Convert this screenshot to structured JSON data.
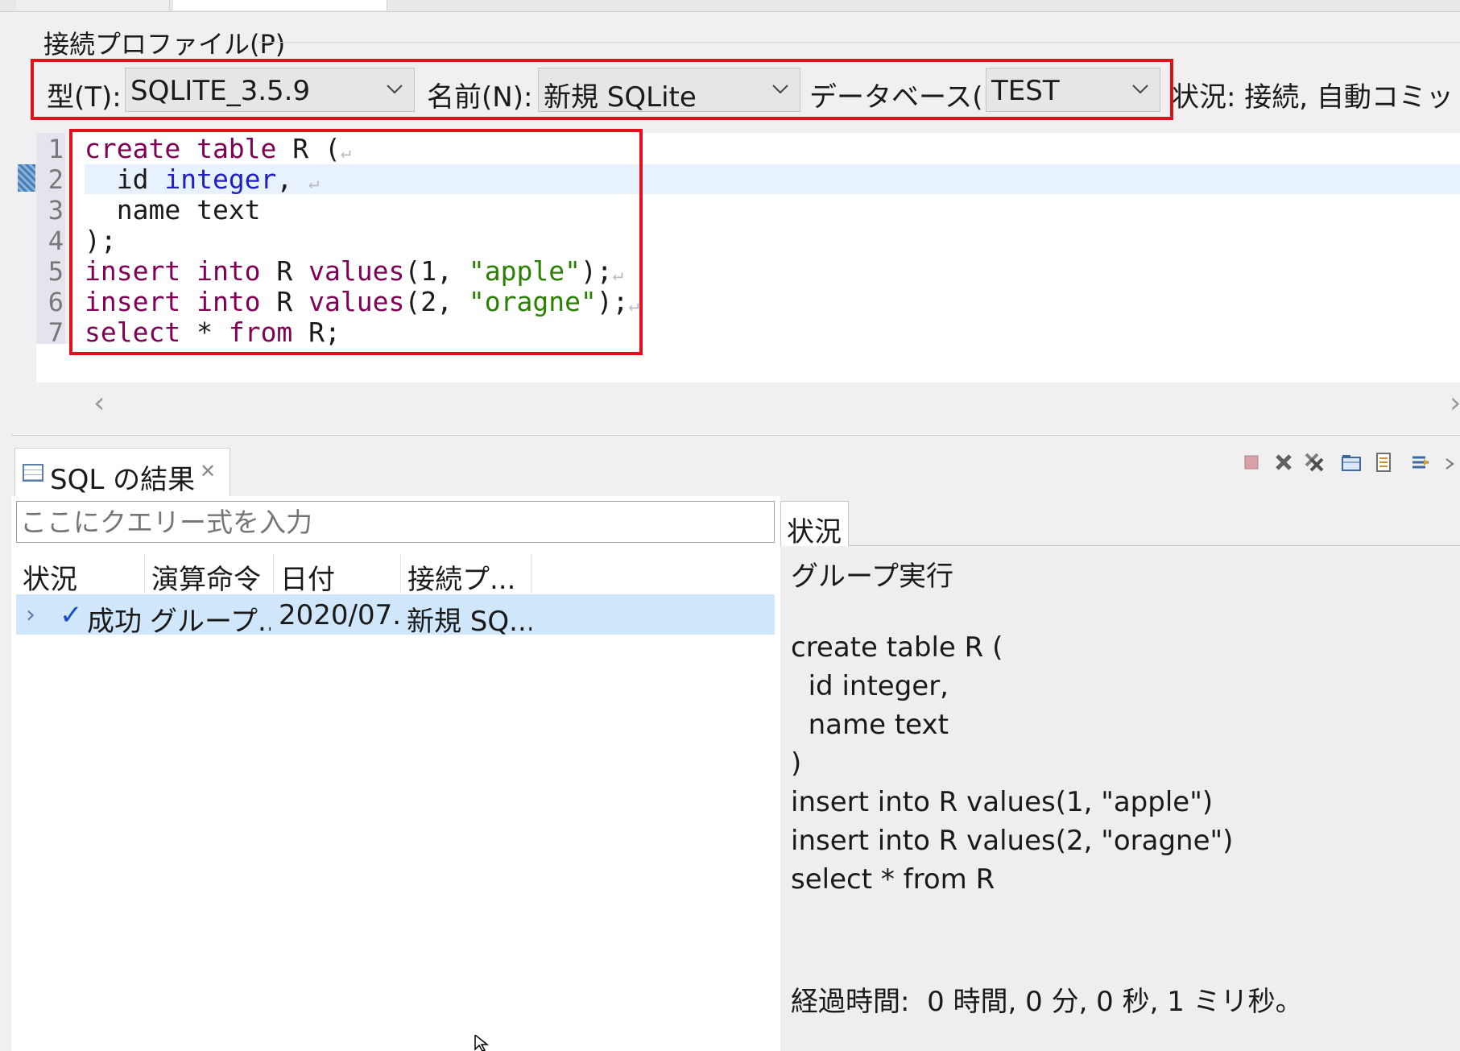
{
  "profile": {
    "title": "接続プロファイル(P)",
    "type_label": "型(T):",
    "type_value": "SQLITE_3.5.9",
    "name_label": "名前(N):",
    "name_value": "新規 SQLite",
    "database_label": "データベース(B):",
    "database_value": "TEST",
    "status_text": "状況: 接続, 自動コミット"
  },
  "editor": {
    "line_numbers": [
      "1",
      "2",
      "3",
      "4",
      "5",
      "6",
      "7"
    ],
    "lines": [
      [
        {
          "t": "create table",
          "c": "kw"
        },
        {
          "t": " R (",
          "c": ""
        }
      ],
      [
        {
          "t": "  id ",
          "c": ""
        },
        {
          "t": "integer",
          "c": "ty"
        },
        {
          "t": ", ",
          "c": ""
        }
      ],
      [
        {
          "t": "  name text",
          "c": ""
        }
      ],
      [
        {
          "t": ");",
          "c": ""
        }
      ],
      [
        {
          "t": "insert into",
          "c": "kw"
        },
        {
          "t": " R ",
          "c": ""
        },
        {
          "t": "values",
          "c": "kw"
        },
        {
          "t": "(1, ",
          "c": ""
        },
        {
          "t": "\"apple\"",
          "c": "st"
        },
        {
          "t": ");",
          "c": ""
        }
      ],
      [
        {
          "t": "insert into",
          "c": "kw"
        },
        {
          "t": " R ",
          "c": ""
        },
        {
          "t": "values",
          "c": "kw"
        },
        {
          "t": "(2, ",
          "c": ""
        },
        {
          "t": "\"oragne\"",
          "c": "st"
        },
        {
          "t": ");",
          "c": ""
        }
      ],
      [
        {
          "t": "select",
          "c": "kw"
        },
        {
          "t": " * ",
          "c": ""
        },
        {
          "t": "from",
          "c": "kw"
        },
        {
          "t": " R;",
          "c": ""
        }
      ]
    ],
    "newline_marker": "↵"
  },
  "results": {
    "tab_title": "SQL の結果",
    "query_placeholder": "ここにクエリー式を入力",
    "columns": [
      "状況",
      "演算命令",
      "日付",
      "接続プ..."
    ],
    "rows": [
      {
        "status": "成功",
        "operation": "グループ...",
        "date": "2020/07...",
        "connection": "新規 SQ..."
      }
    ]
  },
  "status_panel": {
    "tab_label": "状況",
    "lines": [
      "グループ実行",
      "",
      "create table R (",
      "  id integer,",
      "  name text",
      ")",
      "insert into R values(1, \"apple\")",
      "insert into R values(2, \"oragne\")",
      "select * from R",
      "",
      "",
      "経過時間:  0 時間, 0 分, 0 秒, 1 ミリ秒。"
    ]
  },
  "colors": {
    "highlight_border": "#e2101c",
    "keyword": "#7f0055",
    "type": "#2020c0",
    "string": "#2a8000",
    "selected_row": "#cfe6fb"
  },
  "icons": [
    "stop-icon",
    "remove-icon",
    "remove-all-icon",
    "open-table-icon",
    "save-results-icon",
    "pin-icon"
  ]
}
